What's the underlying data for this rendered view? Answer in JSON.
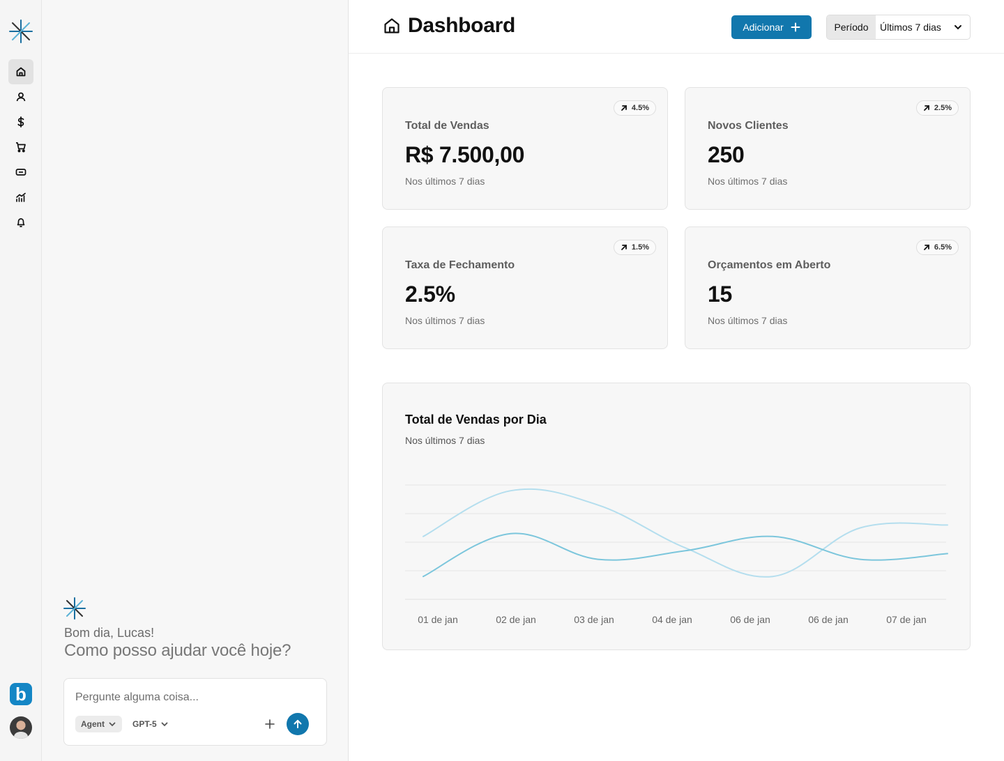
{
  "colors": {
    "accent": "#1177ad",
    "brand": "#1486c5",
    "series_primary": "#7cc6dc",
    "series_secondary": "#b4deee",
    "grid": "#e6e6e6"
  },
  "rail": {
    "items": [
      {
        "name": "home",
        "icon": "home-icon",
        "active": true
      },
      {
        "name": "users",
        "icon": "user-icon",
        "active": false
      },
      {
        "name": "finance",
        "icon": "dollar-icon",
        "active": false
      },
      {
        "name": "orders",
        "icon": "cart-icon",
        "active": false
      },
      {
        "name": "payments",
        "icon": "ticket-icon",
        "active": false
      },
      {
        "name": "reports",
        "icon": "bar-chart-icon",
        "active": false
      },
      {
        "name": "notifications",
        "icon": "bell-icon",
        "active": false
      }
    ],
    "brand_letter": "b"
  },
  "chat": {
    "greeting": "Bom dia, Lucas!",
    "prompt": "Como posso ajudar você hoje?",
    "input_placeholder": "Pergunte alguma coisa...",
    "input_value": "",
    "mode_label": "Agent",
    "model_label": "GPT-5"
  },
  "header": {
    "title": "Dashboard",
    "add_label": "Adicionar",
    "period_label": "Período",
    "period_value": "Últimos 7 dias"
  },
  "kpis": [
    {
      "label": "Total de Vendas",
      "value": "R$ 7.500,00",
      "subtitle": "Nos últimos 7 dias",
      "badge": "4.5%"
    },
    {
      "label": "Novos Clientes",
      "value": "250",
      "subtitle": "Nos últimos 7 dias",
      "badge": "2.5%"
    },
    {
      "label": "Taxa de Fechamento",
      "value": "2.5%",
      "subtitle": "Nos últimos 7 dias",
      "badge": "1.5%"
    },
    {
      "label": "Orçamentos em Aberto",
      "value": "15",
      "subtitle": "Nos últimos 7 dias",
      "badge": "6.5%"
    }
  ],
  "chart_data": {
    "type": "line",
    "title": "Total de Vendas por Dia",
    "subtitle": "Nos últimos 7 dias",
    "categories": [
      "01 de jan",
      "02 de jan",
      "03 de jan",
      "04 de jan",
      "06 de jan",
      "06 de jan",
      "07 de jan"
    ],
    "ylim": [
      0,
      4
    ],
    "grid": true,
    "legend": "none",
    "series": [
      {
        "values": [
          2.2,
          3.8,
          3.3,
          1.8,
          0.8,
          2.5,
          2.6
        ]
      },
      {
        "values": [
          0.8,
          2.3,
          1.4,
          1.7,
          2.2,
          1.4,
          1.6
        ]
      }
    ]
  }
}
